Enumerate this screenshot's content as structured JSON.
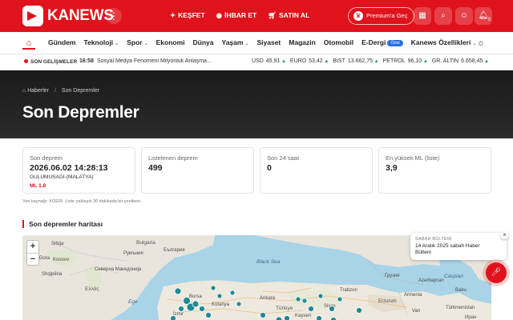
{
  "brand": {
    "name": "KANEWS"
  },
  "header": {
    "more_icon": "more-dots-icon",
    "nav": [
      {
        "icon": "sparkle-icon",
        "label": "KEŞFET"
      },
      {
        "icon": "whatsapp-icon",
        "label": "İHBAR ET"
      },
      {
        "icon": "cart-icon",
        "label": "SATIN AL"
      }
    ],
    "premium_label": "Premium'a Geç",
    "notification_count": "0"
  },
  "categories": [
    {
      "label": "Gündem",
      "has_menu": false
    },
    {
      "label": "Teknoloji",
      "has_menu": true
    },
    {
      "label": "Spor",
      "has_menu": true
    },
    {
      "label": "Ekonomi",
      "has_menu": false
    },
    {
      "label": "Dünya",
      "has_menu": false
    },
    {
      "label": "Yaşam",
      "has_menu": true
    },
    {
      "label": "Siyaset",
      "has_menu": false
    },
    {
      "label": "Magazin",
      "has_menu": false
    },
    {
      "label": "Otomobil",
      "has_menu": false
    },
    {
      "label": "E-Dergi",
      "has_menu": false,
      "badge": "Özel"
    },
    {
      "label": "Kanews Özellikleri",
      "has_menu": true
    }
  ],
  "ticker": {
    "label": "SON GELİŞMELER",
    "time": "16:58",
    "text": "Sosyal Medya Fenomeni Milyonluk Anlaşma...",
    "markets": [
      {
        "name": "USD",
        "value": "45,91"
      },
      {
        "name": "EURO",
        "value": "53,42"
      },
      {
        "name": "BIST",
        "value": "13.662,75"
      },
      {
        "name": "PETROL",
        "value": "96,10"
      },
      {
        "name": "GR. ALTIN",
        "value": "6.658,45"
      }
    ]
  },
  "breadcrumb": {
    "home": "Haberler",
    "current": "Son Depremler"
  },
  "page_title": "Son Depremler",
  "stats": {
    "last": {
      "label": "Son deprem",
      "datetime": "2026.06.02 14:28:13",
      "location": "GULUMUSAGI-(MALATYA)",
      "magnitude": "ML 1.8"
    },
    "listed": {
      "label": "Listelenen deprem",
      "value": "499"
    },
    "last24": {
      "label": "Son 24 saat",
      "value": "0"
    },
    "max_ml": {
      "label": "En yüksek ML (liste)",
      "value": "3,9"
    }
  },
  "source_note": "Veri kaynağı: KOERI. Liste yaklaşık 30 dakikada bir yenilenir.",
  "map": {
    "title": "Son depremler haritası",
    "zoom_in": "+",
    "zoom_out": "−",
    "labels": [
      "Srbija",
      "България",
      "Bulgaria",
      "Румъния",
      "Crna Gora",
      "Kosovo",
      "Северна Македонија",
      "Shqipëria",
      "Ελλάς",
      "Bursa",
      "İzmir",
      "Kütahya",
      "Ankara",
      "Türkiye",
      "Trabzon",
      "Sivas",
      "Van",
      "Kayseri",
      "Erzurum",
      "Грузия",
      "Armenia",
      "Azərbaycan",
      "Baku",
      "Türkmenistan",
      "Иран"
    ],
    "seas": [
      "Black Sea",
      "Ege",
      "Caspian"
    ]
  },
  "bulletin": {
    "heading": "SABAH BÜLTENİ",
    "text": "14 Aralık 2025 sabah Haber Bülteni",
    "close": "×"
  },
  "colors": {
    "brand_red": "#e0121b",
    "hero_dark": "#1e1e1e",
    "map_water": "#a9d3e6",
    "quake_marker": "#1f8a96"
  }
}
